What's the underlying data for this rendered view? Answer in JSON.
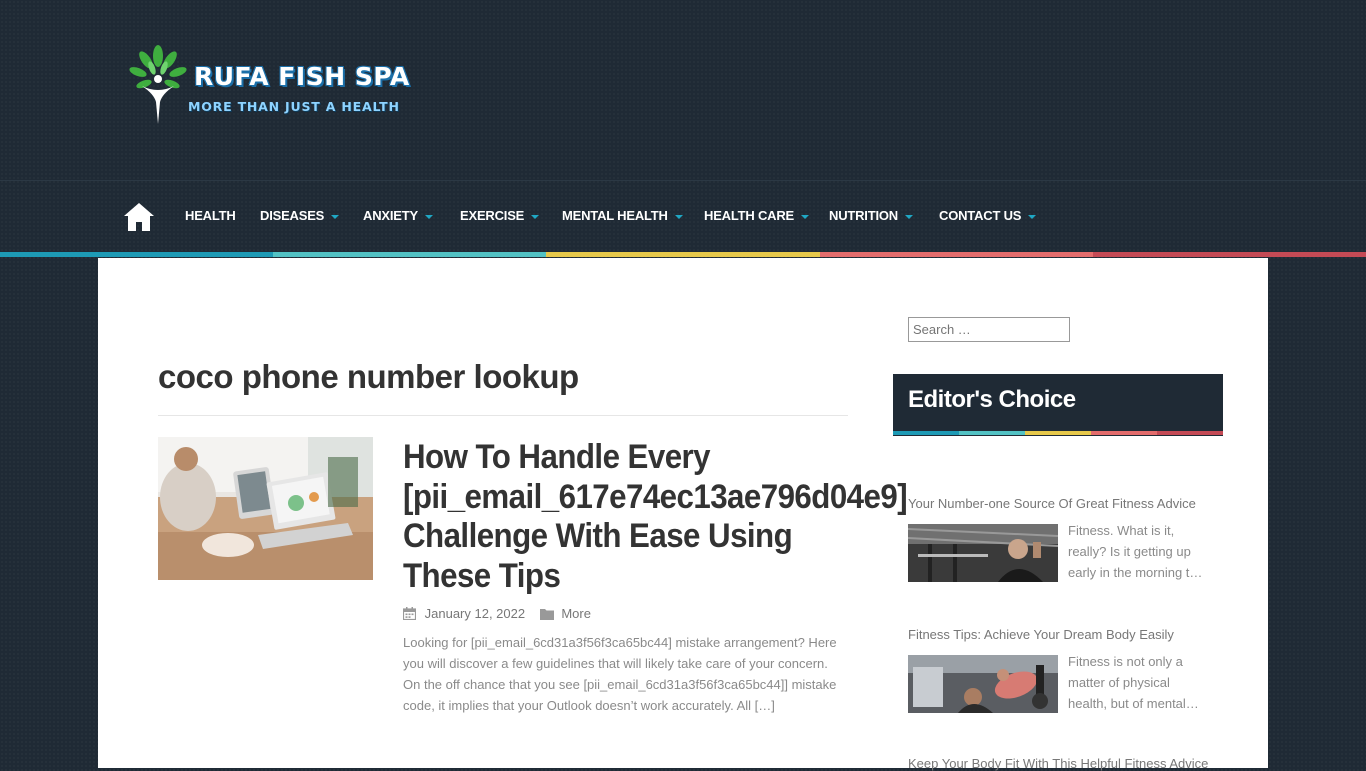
{
  "site": {
    "title": "RUFA FISH SPA",
    "tagline": "MORE THAN JUST A HEALTH"
  },
  "nav": {
    "home_icon": "home-icon",
    "items": [
      {
        "label": "HEALTH",
        "dropdown": false
      },
      {
        "label": "DISEASES",
        "dropdown": true
      },
      {
        "label": "ANXIETY",
        "dropdown": true
      },
      {
        "label": "EXERCISE",
        "dropdown": true
      },
      {
        "label": "MENTAL HEALTH",
        "dropdown": true
      },
      {
        "label": "HEALTH CARE",
        "dropdown": true
      },
      {
        "label": "NUTRITION",
        "dropdown": true
      },
      {
        "label": "CONTACT US",
        "dropdown": true
      }
    ],
    "stripe_colors": [
      "#1d9ab5",
      "#52c2c4",
      "#e6c84a",
      "#e36c6c",
      "#c44a55"
    ]
  },
  "main": {
    "page_title": "coco phone number lookup",
    "post": {
      "title": "How To Handle Every [pii_email_617e74ec13ae796d04e9] Challenge With Ease Using These Tips",
      "date": "January 12, 2022",
      "category": "More",
      "excerpt": "Looking for [pii_email_6cd31a3f56f3ca65bc44] mistake arrangement? Here you will discover a few guidelines that will likely take care of your concern. On the off chance that you see [pii_email_6cd31a3f56f3ca65bc44]] mistake code, it implies that your Outlook doesn’t work accurately. All […]"
    }
  },
  "sidebar": {
    "search_placeholder": "Search …",
    "widget_title": "Editor's Choice",
    "posts": [
      {
        "title": "Your Number-one Source Of Great Fitness Advice",
        "excerpt": "Fitness. What is it, really? Is it getting up early in the morning t…"
      },
      {
        "title": "Fitness Tips: Achieve Your Dream Body Easily",
        "excerpt": "Fitness is not only a matter of physical health, but of mental…"
      },
      {
        "title": "Keep Your Body Fit With This Helpful Fitness Advice",
        "excerpt": ""
      }
    ]
  },
  "colors": {
    "background": "#1f2a35",
    "accent": "#1fa7c4",
    "content_bg": "#ffffff"
  }
}
